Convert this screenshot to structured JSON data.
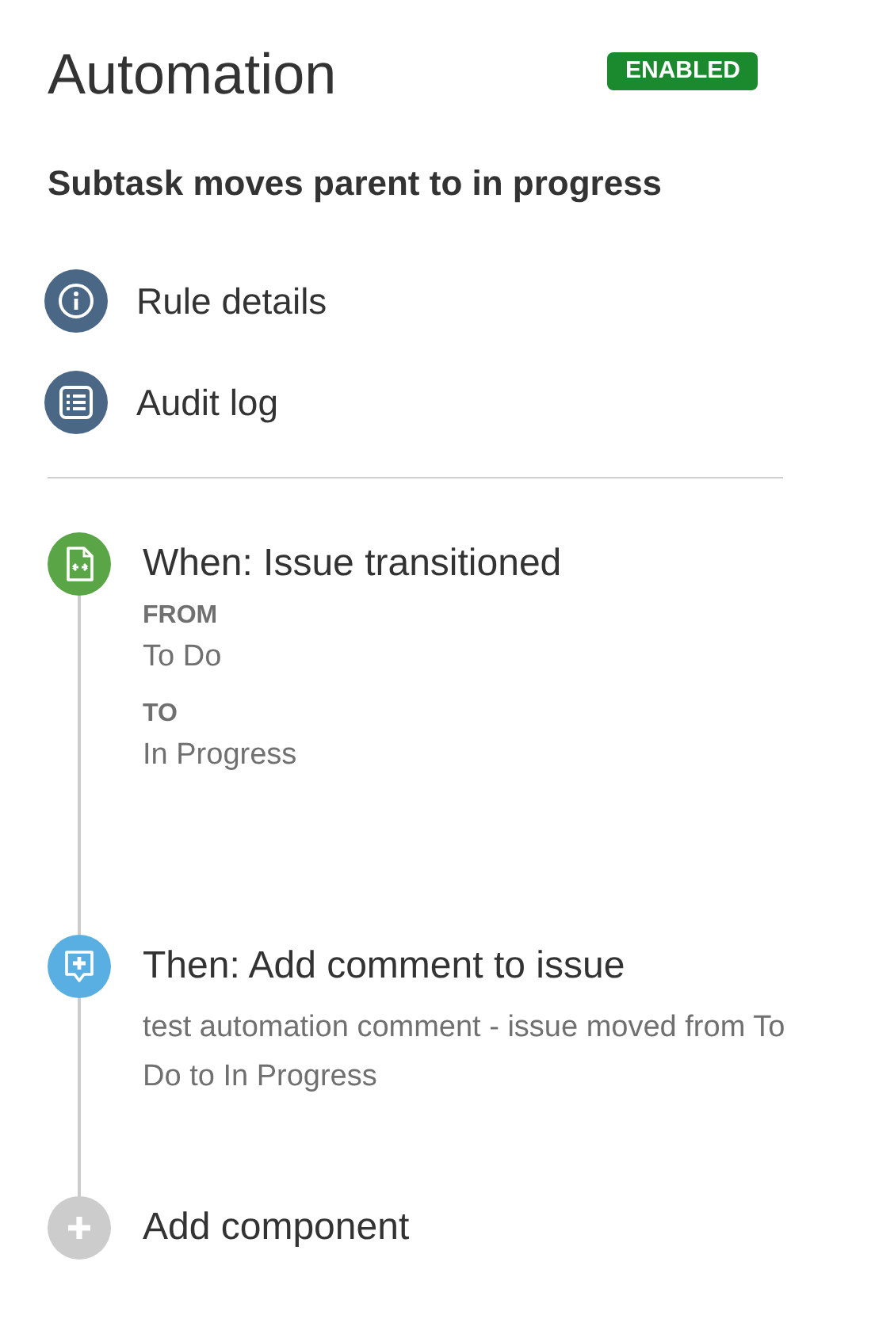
{
  "header": {
    "title": "Automation",
    "status_badge": "ENABLED"
  },
  "rule_name": "Subtask moves parent to in progress",
  "menu": [
    {
      "kind": "info",
      "label": "Rule details"
    },
    {
      "kind": "log",
      "label": "Audit log"
    }
  ],
  "components": [
    {
      "kind": "trigger",
      "title": "When: Issue transitioned",
      "details": [
        {
          "label": "FROM",
          "value": "To Do"
        },
        {
          "label": "TO",
          "value": "In Progress"
        }
      ]
    },
    {
      "kind": "action",
      "title": "Then: Add comment to issue",
      "text": "test automation comment - issue moved from To Do to In Progress"
    },
    {
      "kind": "add",
      "title": "Add component"
    }
  ]
}
